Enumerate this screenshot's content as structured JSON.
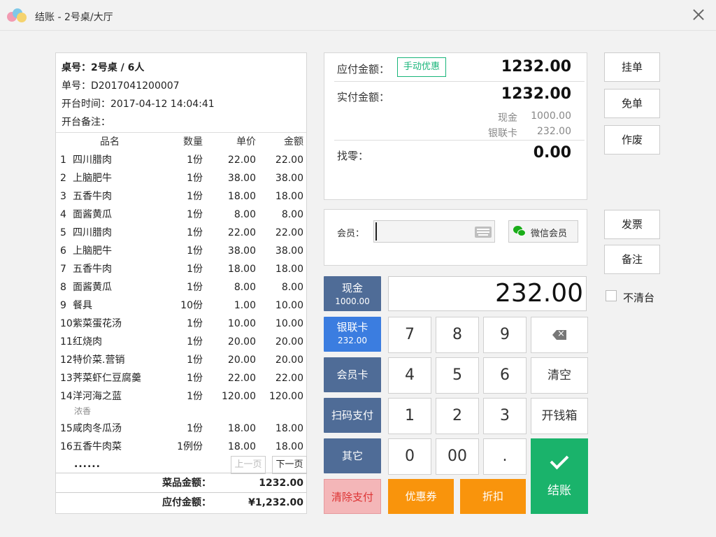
{
  "window": {
    "title": "结账 - 2号桌/大厅"
  },
  "order": {
    "table": "桌号：2号桌 / 6人",
    "order_no": "单号：D2017041200007",
    "open_time": "开台时间：2017-04-12 14:04:41",
    "remark": "开台备注："
  },
  "items_header": {
    "name": "品名",
    "qty": "数量",
    "price": "单价",
    "amount": "金额"
  },
  "items": [
    {
      "no": "1",
      "name": "四川腊肉",
      "qty": "1份",
      "price": "22.00",
      "amount": "22.00"
    },
    {
      "no": "2",
      "name": "上脑肥牛",
      "qty": "1份",
      "price": "38.00",
      "amount": "38.00"
    },
    {
      "no": "3",
      "name": "五香牛肉",
      "qty": "1份",
      "price": "18.00",
      "amount": "18.00"
    },
    {
      "no": "4",
      "name": "面酱黄瓜",
      "qty": "1份",
      "price": "8.00",
      "amount": "8.00"
    },
    {
      "no": "5",
      "name": "四川腊肉",
      "qty": "1份",
      "price": "22.00",
      "amount": "22.00"
    },
    {
      "no": "6",
      "name": "上脑肥牛",
      "qty": "1份",
      "price": "38.00",
      "amount": "38.00"
    },
    {
      "no": "7",
      "name": "五香牛肉",
      "qty": "1份",
      "price": "18.00",
      "amount": "18.00"
    },
    {
      "no": "8",
      "name": "面酱黄瓜",
      "qty": "1份",
      "price": "8.00",
      "amount": "8.00"
    },
    {
      "no": "9",
      "name": "餐具",
      "qty": "10份",
      "price": "1.00",
      "amount": "10.00"
    },
    {
      "no": "10",
      "name": "紫菜蛋花汤",
      "qty": "1份",
      "price": "10.00",
      "amount": "10.00"
    },
    {
      "no": "11",
      "name": "红烧肉",
      "qty": "1份",
      "price": "20.00",
      "amount": "20.00"
    },
    {
      "no": "12",
      "name": "特价菜.营销",
      "qty": "1份",
      "price": "20.00",
      "amount": "20.00"
    },
    {
      "no": "13",
      "name": "荠菜虾仁豆腐羹",
      "qty": "1份",
      "price": "22.00",
      "amount": "22.00"
    },
    {
      "no": "14",
      "name": "洋河海之蓝",
      "qty": "1份",
      "price": "120.00",
      "amount": "120.00",
      "note": "浓香"
    },
    {
      "no": "15",
      "name": "咸肉冬瓜汤",
      "qty": "1份",
      "price": "18.00",
      "amount": "18.00"
    },
    {
      "no": "16",
      "name": "五香牛肉菜",
      "qty": "1例份",
      "price": "18.00",
      "amount": "18.00"
    }
  ],
  "items_more": "......",
  "pager": {
    "prev": "上一页",
    "next": "下一页"
  },
  "totals": {
    "dish_label": "菜品金额：",
    "dish_value": "1232.00",
    "due_label": "应付金额：",
    "due_value": "¥1,232.00"
  },
  "payment": {
    "due_label": "应付金额：",
    "due_value": "1232.00",
    "manual_discount": "手动优惠",
    "paid_label": "实付金额：",
    "paid_value": "1232.00",
    "cash_label": "现金",
    "cash_value": "1000.00",
    "card_label": "银联卡",
    "card_value": "232.00",
    "change_label": "找零：",
    "change_value": "0.00"
  },
  "member": {
    "label": "会员：",
    "input_value": "",
    "wechat_button": "微信会员"
  },
  "methods": [
    {
      "label": "现金",
      "amount": "1000.00"
    },
    {
      "label": "银联卡",
      "amount": "232.00"
    },
    {
      "label": "会员卡",
      "amount": ""
    },
    {
      "label": "扫码支付",
      "amount": ""
    },
    {
      "label": "其它",
      "amount": ""
    }
  ],
  "amount_display": "232.00",
  "keypad": {
    "k7": "7",
    "k8": "8",
    "k9": "9",
    "k4": "4",
    "k5": "5",
    "k6": "6",
    "clear": "清空",
    "k1": "1",
    "k2": "2",
    "k3": "3",
    "drawer": "开钱箱",
    "k0": "0",
    "k00": "00",
    "dot": "."
  },
  "checkout": "结账",
  "actions": {
    "clear_payment": "清除支付",
    "coupon": "优惠券",
    "discount": "折扣"
  },
  "side": {
    "hold": "挂单",
    "free": "免单",
    "void": "作废",
    "invoice": "发票",
    "note": "备注",
    "keep_table": "不清台"
  },
  "colors": {
    "accent_green": "#1ab36b",
    "slate": "#4f6c97",
    "blue": "#3b7de0",
    "orange": "#f9940c",
    "pink": "#f4b6b8"
  }
}
